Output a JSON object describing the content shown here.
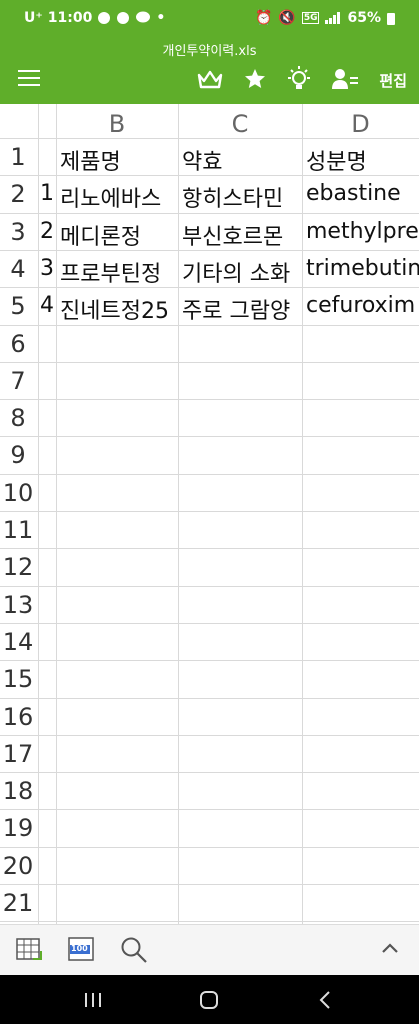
{
  "status": {
    "carrier": "U⁺",
    "time": "11:00",
    "battery": "65%",
    "network": "5G"
  },
  "file": {
    "name": "개인투약이력.xls"
  },
  "toolbar": {
    "icons": [
      "crown-icon",
      "star-icon",
      "lightbulb-icon",
      "user-share-icon"
    ],
    "edit_label": "편집"
  },
  "sheet": {
    "column_headers": [
      "B",
      "C",
      "D"
    ],
    "row_numbers": [
      "1",
      "2",
      "3",
      "4",
      "5",
      "6",
      "7",
      "8",
      "9",
      "10",
      "11",
      "12",
      "13",
      "14",
      "15",
      "16",
      "17",
      "18",
      "19",
      "20",
      "21"
    ],
    "rows": [
      {
        "a": "",
        "b": "제품명",
        "c": "약효",
        "d": "성분명"
      },
      {
        "a": "1",
        "b": "리노에바스",
        "c": "항히스타민",
        "d": "ebastine"
      },
      {
        "a": "2",
        "b": "메디론정",
        "c": "부신호르몬",
        "d": "methylpre"
      },
      {
        "a": "3",
        "b": "프로부틴정",
        "c": "기타의 소화",
        "d": "trimebutin"
      },
      {
        "a": "4",
        "b": "진네트정25",
        "c": "주로 그람양",
        "d": "cefuroxim"
      }
    ]
  },
  "bottom": {
    "icons": [
      "sheet-grid-icon",
      "zoom-100-icon",
      "search-icon",
      "chevron-up-icon"
    ],
    "zoom_badge": "100"
  },
  "nav": {
    "icons": [
      "recent-apps-icon",
      "home-icon",
      "back-icon"
    ]
  }
}
